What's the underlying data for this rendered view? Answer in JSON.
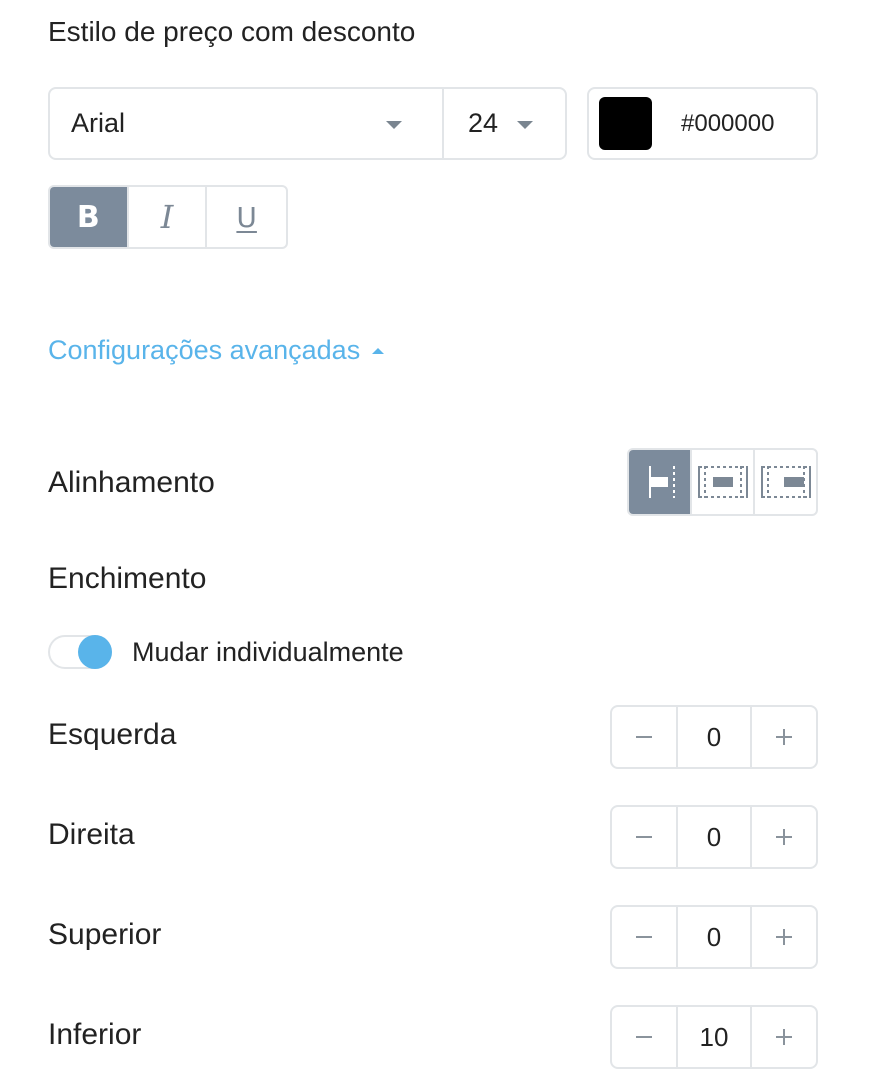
{
  "section_title": "Estilo de preço com desconto",
  "font": {
    "family": "Arial",
    "size": "24",
    "icon": "chevron-down-icon"
  },
  "color": {
    "swatch": "#000000",
    "hex": "#000000"
  },
  "text_styles": [
    {
      "name": "bold",
      "glyph": "B",
      "active": true
    },
    {
      "name": "italic",
      "glyph": "I",
      "active": false
    },
    {
      "name": "underline",
      "glyph": "U",
      "active": false
    }
  ],
  "advanced": {
    "label": "Configurações avançadas",
    "icon": "caret-up-icon"
  },
  "alignment": {
    "label": "Alinhamento",
    "options": [
      "align-left-icon",
      "align-center-icon",
      "align-right-icon"
    ],
    "selected": "left"
  },
  "padding": {
    "label": "Enchimento",
    "toggle_label": "Mudar individualmente",
    "toggle_on": true,
    "rows": [
      {
        "label": "Esquerda",
        "value": "0"
      },
      {
        "label": "Direita",
        "value": "0"
      },
      {
        "label": "Superior",
        "value": "0"
      },
      {
        "label": "Inferior",
        "value": "10"
      }
    ]
  },
  "colors": {
    "accent": "#59b4ea",
    "active_button": "#7c8b9c",
    "border": "#e2e5e8"
  }
}
